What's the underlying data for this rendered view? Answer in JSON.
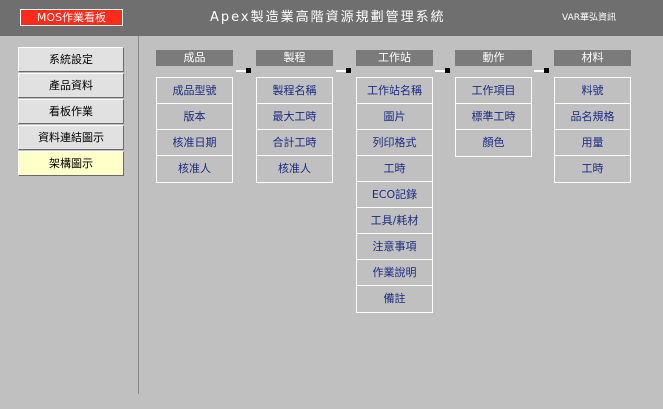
{
  "header": {
    "badge": "MOS作業看板",
    "title": "Apex製造業高階資源規劃管理系統",
    "company": "VAR華弘資訊"
  },
  "sidebar": {
    "items": [
      {
        "label": "系統設定"
      },
      {
        "label": "產品資料"
      },
      {
        "label": "看板作業"
      },
      {
        "label": "資料連結圖示"
      },
      {
        "label": "架構圖示"
      }
    ]
  },
  "diagram": {
    "columns": [
      {
        "title": "成品",
        "items": [
          "成品型號",
          "版本",
          "核准日期",
          "核准人"
        ]
      },
      {
        "title": "製程",
        "items": [
          "製程名稱",
          "最大工時",
          "合計工時",
          "核准人"
        ]
      },
      {
        "title": "工作站",
        "items": [
          "工作站名稱",
          "圖片",
          "列印格式",
          "工時",
          "ECO記錄",
          "工具/耗材",
          "注意事項",
          "作業說明",
          "備註"
        ]
      },
      {
        "title": "動作",
        "items": [
          "工作項目",
          "標準工時",
          "顏色"
        ]
      },
      {
        "title": "材料",
        "items": [
          "料號",
          "品名規格",
          "用量",
          "工時"
        ]
      }
    ]
  }
}
